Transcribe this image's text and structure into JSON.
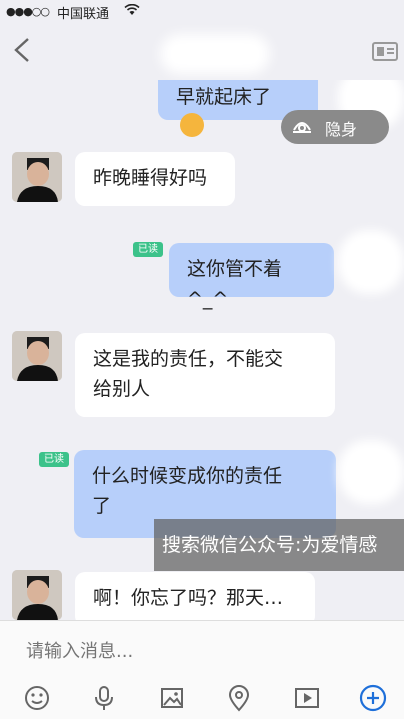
{
  "status": {
    "signal": "●●●○○",
    "carrier": "中国联通"
  },
  "messages": {
    "top_partial": "早就起床了",
    "m1": "昨晚睡得好吗",
    "m2": "这你管不着^_^",
    "m3_line1": "这是我的责任，不能交",
    "m3_line2": "给别人",
    "m4_line1": "什么时候变成你的责任",
    "m4_line2": "了",
    "m5": "啊！你忘了吗？那天…"
  },
  "read_label": "已读",
  "hidden_mode": "隐身",
  "watermark": "搜索微信公众号:为爱情感",
  "input": {
    "placeholder": "请输入消息..."
  },
  "toolbar": [
    "emoji-icon",
    "mic-icon",
    "image-icon",
    "location-icon",
    "video-icon",
    "add-icon"
  ],
  "colors": {
    "out_bubble": "#b7cffa",
    "in_bubble": "#ffffff",
    "read_badge": "#3cc28a",
    "accent": "#1e6fd9"
  }
}
